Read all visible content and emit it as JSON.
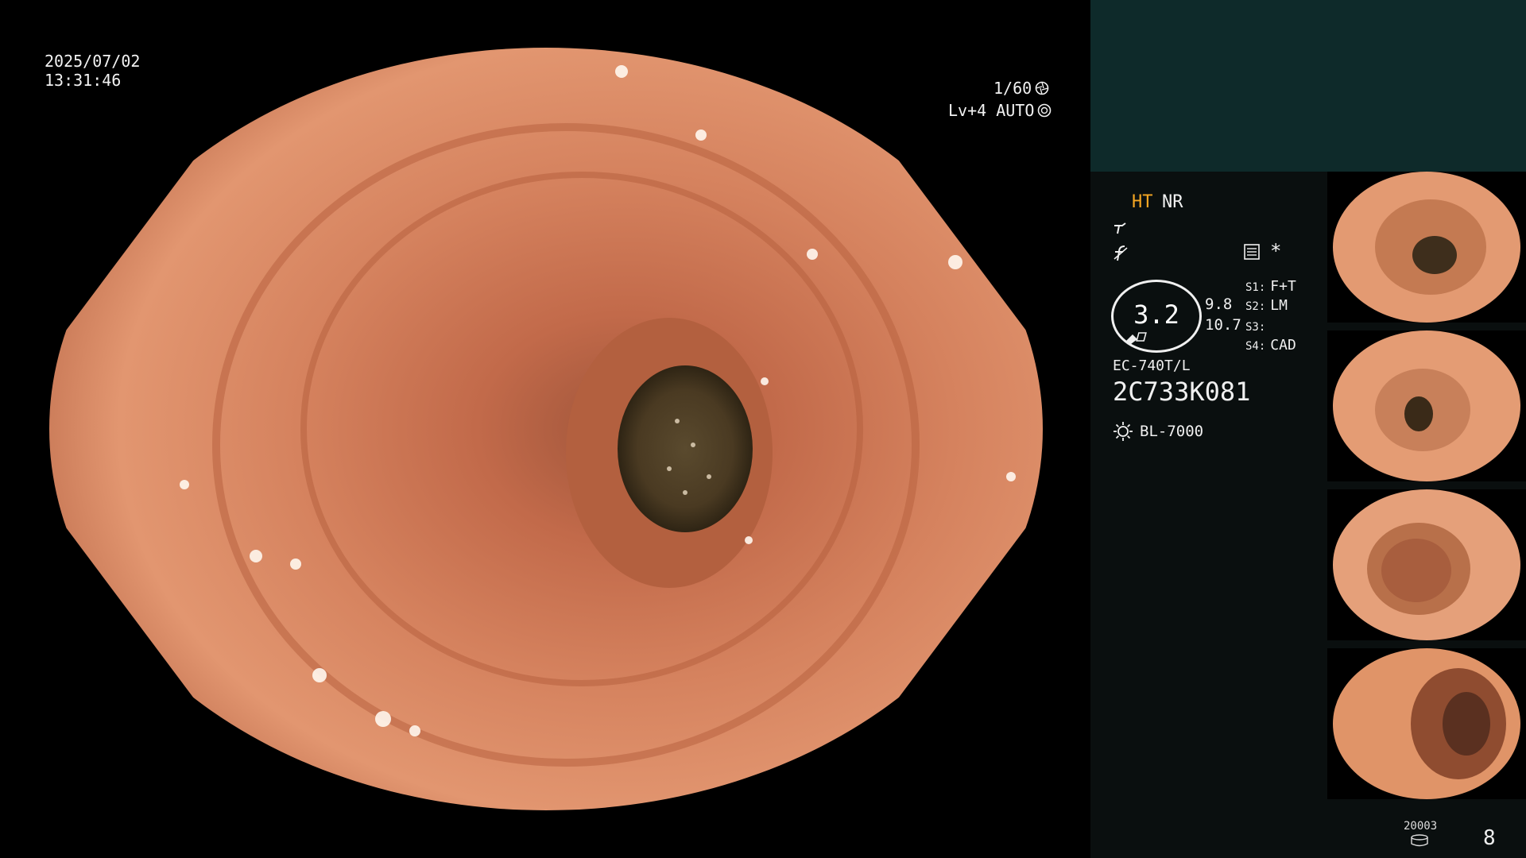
{
  "overlay": {
    "date": "2025/07/02",
    "time": "13:31:46",
    "shutter": "1/60",
    "level": "Lv+4 AUTO",
    "shutter_icon": "aperture-icon",
    "auto_icon": "iris-icon"
  },
  "panel": {
    "ht": "HT",
    "nr": "NR",
    "asterisk": "*",
    "zoom": "3.2",
    "zoom_values": [
      "9.8",
      "10.7"
    ],
    "settings": [
      {
        "key": "S1:",
        "value": "F+T"
      },
      {
        "key": "S2:",
        "value": "LM"
      },
      {
        "key": "S3:",
        "value": ""
      },
      {
        "key": "S4:",
        "value": "CAD"
      }
    ],
    "scope_model": "EC-740T/L",
    "serial": "2C733K081",
    "light_source": "BL-7000"
  },
  "footer": {
    "storage_code": "20003",
    "image_count": "8"
  },
  "colors": {
    "mucosa": "#d9825c",
    "ht_accent": "#f5a623",
    "panel_top": "#0e2a2a"
  }
}
